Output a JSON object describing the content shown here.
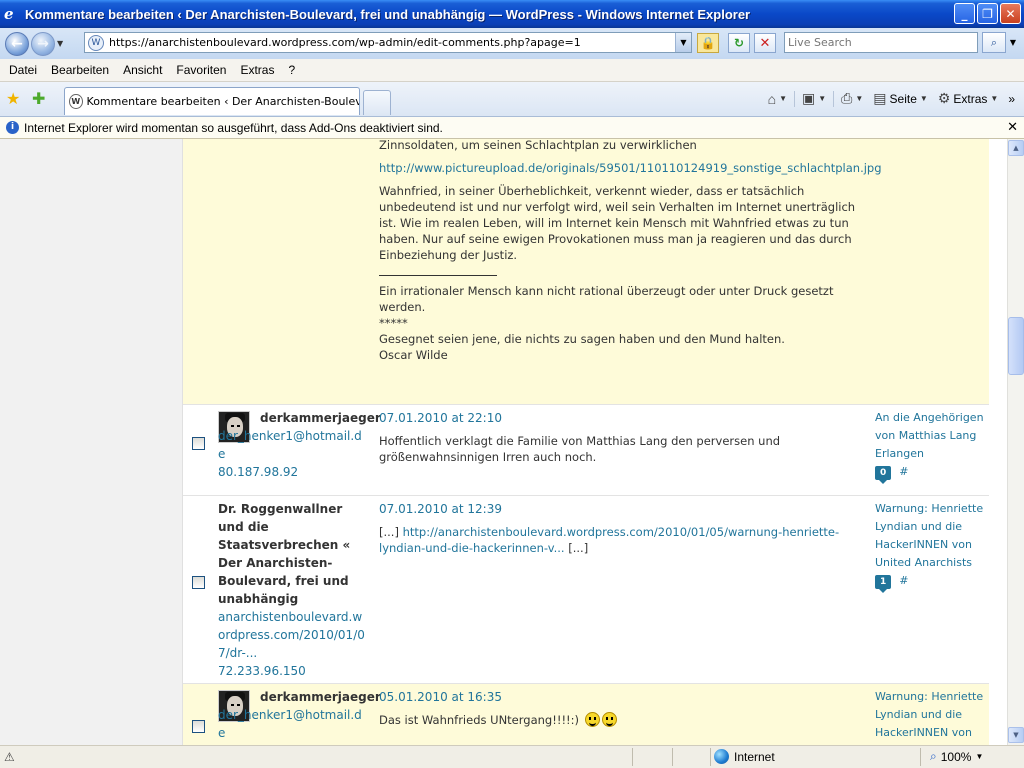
{
  "window": {
    "title": "Kommentare bearbeiten ‹ Der Anarchisten-Boulevard, frei und unabhängig — WordPress - Windows Internet Explorer"
  },
  "address": {
    "url": "https://anarchistenboulevard.wordpress.com/wp-admin/edit-comments.php?apage=1"
  },
  "search": {
    "placeholder": "Live Search"
  },
  "menu": [
    "Datei",
    "Bearbeiten",
    "Ansicht",
    "Favoriten",
    "Extras",
    "?"
  ],
  "tab": {
    "label": "Kommentare bearbeiten ‹ Der Anarchisten-Boulevard,..."
  },
  "commandbar": {
    "page_label": "Seite",
    "tools_label": "Extras"
  },
  "infobar": {
    "text": "Internet Explorer wird momentan so ausgeführt, dass Add-Ons deaktiviert sind."
  },
  "first_comment_tail": {
    "line1": "Zinnsoldaten, um seinen Schlachtplan zu verwirklichen",
    "link": "http://www.pictureupload.de/originals/59501/110110124919_sonstige_schlachtplan.jpg",
    "para": "Wahnfried, in seiner Überheblichkeit, verkennt wieder, dass er tatsächlich unbedeutend ist und nur verfolgt wird, weil sein Verhalten im Internet unerträglich ist. Wie im realen Leben, will im Internet kein Mensch mit Wahnfried etwas zu tun haben. Nur auf seine ewigen Provokationen muss man ja reagieren und das durch Einbeziehung der Justiz.",
    "sig1": "Ein irrationaler Mensch kann nicht rational überzeugt oder unter Druck gesetzt werden.",
    "sig2": "*****",
    "sig3": "Gesegnet seien jene, die nichts zu sagen haben und den Mund halten.",
    "sig4": "Oscar Wilde"
  },
  "comments": [
    {
      "author": "derkammerjaeger",
      "email": "der_henker1@hotmail.de",
      "ip": "80.187.98.92",
      "date": "07.01.2010 at 22:10",
      "text": "Hoffentlich verklagt die Familie von Matthias Lang den perversen und größenwahnsinnigen Irren auch noch.",
      "response_title": "An die Angehörigen von Matthias Lang Erlangen",
      "response_count": "0",
      "hash": "#"
    },
    {
      "author": "Dr. Roggenwallner und die Staatsverbrechen « Der Anarchisten-Boulevard, frei und unabhängig",
      "url": "anarchistenboulevard.wordpress.com/2010/01/07/dr-...",
      "ip": "72.233.96.150",
      "date": "07.01.2010 at 12:39",
      "text_prefix": "[...] ",
      "text_link": "http://anarchistenboulevard.wordpress.com/2010/01/05/warnung-henriette-lyndian-und-die-hackerinnen-v...",
      "text_suffix": " [...]",
      "response_title": "Warnung: Henriette Lyndian und die HackerINNEN von United Anarchists",
      "response_count": "1",
      "hash": "#"
    },
    {
      "author": "derkammerjaeger",
      "email": "der_henker1@hotmail.de",
      "date": "05.01.2010 at 16:35",
      "text": "Das ist Wahnfrieds UNtergang!!!!:)",
      "response_title": "Warnung: Henriette Lyndian und die HackerINNEN von"
    }
  ],
  "status": {
    "zone": "Internet",
    "zoom": "100%"
  },
  "colors": {
    "link": "#21759b",
    "unapproved_bg": "#fefbd9"
  }
}
